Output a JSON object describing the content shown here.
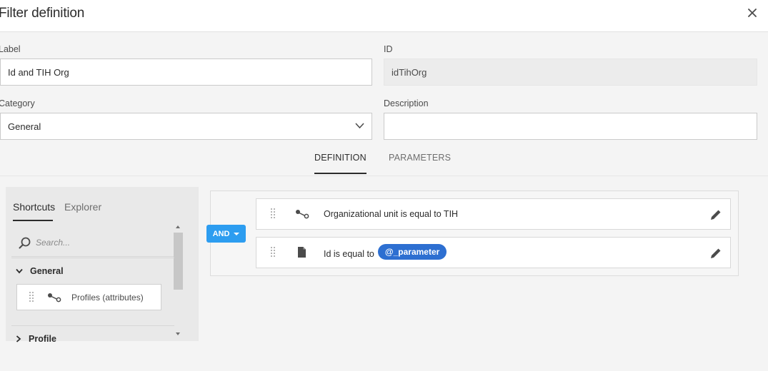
{
  "dialog": {
    "title": "Filter definition"
  },
  "form": {
    "label_caption": "Label",
    "label_value": "Id and TIH Org",
    "id_caption": "ID",
    "id_value": "idTihOrg",
    "category_caption": "Category",
    "category_value": "General",
    "description_caption": "Description",
    "description_value": ""
  },
  "tabs": {
    "definition": "DEFINITION",
    "parameters": "PARAMETERS"
  },
  "palette": {
    "tab_shortcuts": "Shortcuts",
    "tab_explorer": "Explorer",
    "search_placeholder": "Search...",
    "group_general": "General",
    "item_profiles": "Profiles (attributes)",
    "group_profile": "Profile"
  },
  "canvas": {
    "operator": "AND",
    "rule1_text": "Organizational unit is equal to TIH",
    "rule2_text": "Id is equal to",
    "rule2_param": "@_parameter"
  },
  "colors": {
    "accent_blue": "#2d9df0",
    "pill_blue": "#2d6fd1"
  }
}
